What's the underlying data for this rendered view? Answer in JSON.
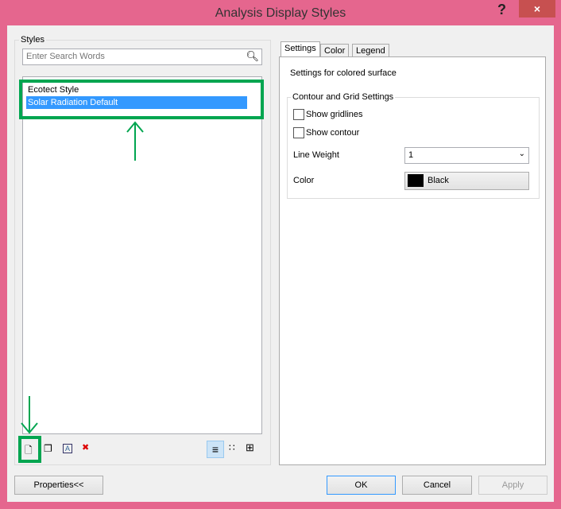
{
  "window": {
    "title": "Analysis Display Styles",
    "help": "?",
    "close": "×"
  },
  "styles": {
    "label": "Styles",
    "search_placeholder": "Enter Search Words",
    "items": [
      "Ecotect Style",
      "Solar Radiation Default"
    ],
    "selected": 1
  },
  "tabs": [
    {
      "label": "Settings",
      "active": true
    },
    {
      "label": "Color"
    },
    {
      "label": "Legend"
    }
  ],
  "settings": {
    "heading": "Settings for colored surface",
    "group": "Contour and Grid Settings",
    "show_gridlines": {
      "label": "Show gridlines",
      "checked": false
    },
    "show_contour": {
      "label": "Show contour",
      "checked": false
    },
    "line_weight": {
      "label": "Line Weight",
      "value": "1"
    },
    "color": {
      "label": "Color",
      "value": "Black",
      "swatch": "#000000"
    }
  },
  "buttons": {
    "properties": "Properties<<",
    "ok": "OK",
    "cancel": "Cancel",
    "apply": "Apply"
  },
  "colors": {
    "selection": "#3399ff",
    "highlight": "#00a550",
    "frame": "#e5668e"
  }
}
